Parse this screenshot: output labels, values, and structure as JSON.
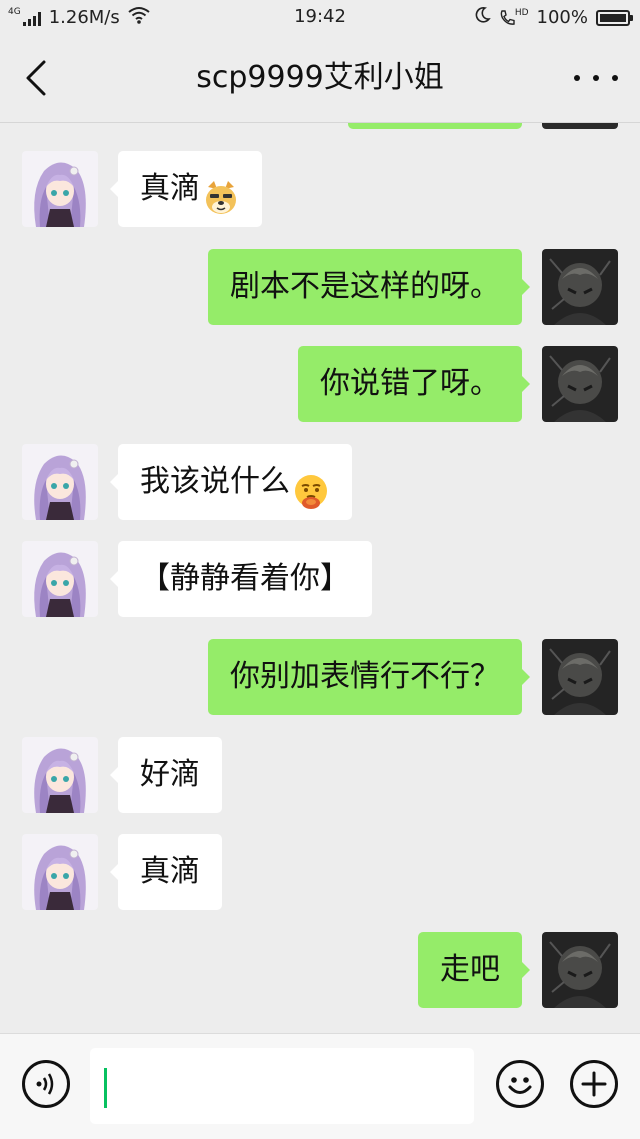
{
  "status_bar": {
    "network_type": "4G",
    "speed": "1.26M/s",
    "time": "19:42",
    "hd_label": "HD",
    "battery_text": "100%",
    "battery_level": 1.0
  },
  "header": {
    "title": "scp9999艾利小姐"
  },
  "messages": [
    {
      "side": "left",
      "text": "真滴",
      "emoji": "doge-emoji"
    },
    {
      "side": "right",
      "text": "剧本不是这样的呀。"
    },
    {
      "side": "right",
      "text": "你说错了呀。"
    },
    {
      "side": "left",
      "text": "我该说什么",
      "emoji": "thinking-hug-emoji"
    },
    {
      "side": "left",
      "text": "【静静看着你】"
    },
    {
      "side": "right",
      "text": "你别加表情行不行？"
    },
    {
      "side": "left",
      "text": "好滴"
    },
    {
      "side": "left",
      "text": "真滴"
    },
    {
      "side": "right",
      "text": "走吧"
    }
  ],
  "input_bar": {
    "value": "",
    "icons": [
      "voice-icon",
      "emoji-icon",
      "plus-icon"
    ]
  },
  "colors": {
    "background": "#ededed",
    "sent_bubble": "#95ec69",
    "received_bubble": "#ffffff",
    "caret": "#07c160"
  }
}
